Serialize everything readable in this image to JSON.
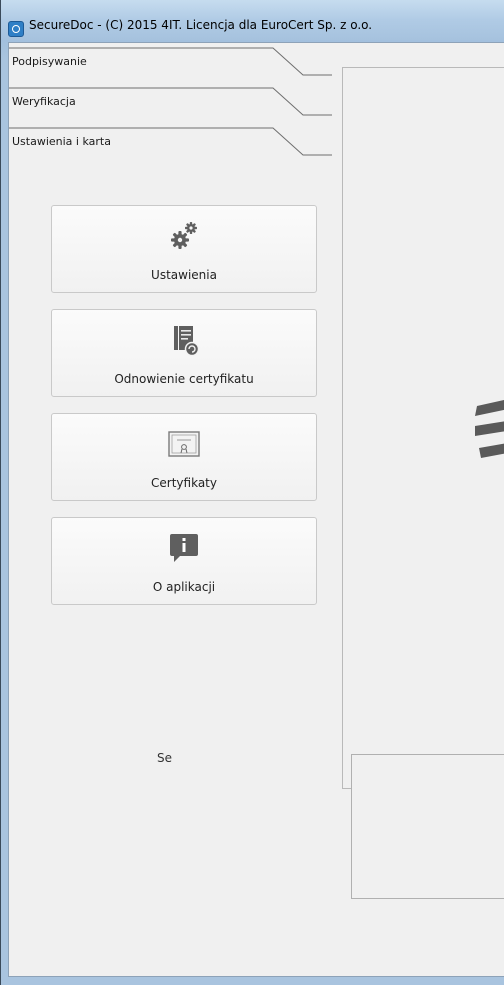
{
  "window": {
    "title": "SecureDoc - (C) 2015 4IT. Licencja dla EuroCert Sp. z o.o."
  },
  "tabs": [
    {
      "label": "Podpisywanie"
    },
    {
      "label": "Weryfikacja"
    },
    {
      "label": "Ustawienia i  karta"
    }
  ],
  "tiles": [
    {
      "label": "Ustawienia",
      "icon": "gears-icon"
    },
    {
      "label": "Odnowienie certyfikatu",
      "icon": "certificate-renew-icon"
    },
    {
      "label": "Certyfikaty",
      "icon": "certificate-icon"
    },
    {
      "label": "O aplikacji",
      "icon": "info-icon"
    }
  ],
  "right_panel": {
    "caption": "Se"
  },
  "colors": {
    "background": "#f0f0f0",
    "titlebar": "#b0cbe5",
    "logo": "#5a5a5a"
  }
}
